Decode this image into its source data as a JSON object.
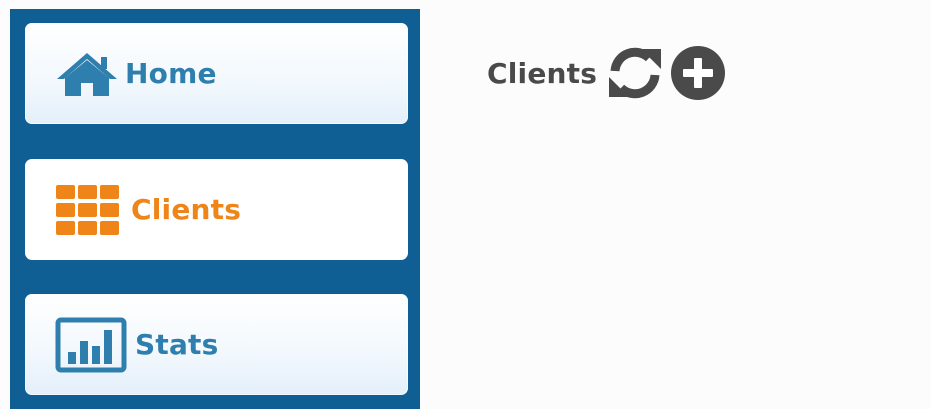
{
  "sidebar": {
    "items": [
      {
        "label": "Home",
        "icon": "home-icon",
        "color": "#2f7fae"
      },
      {
        "label": "Clients",
        "icon": "grid-icon",
        "color": "#ef8418",
        "active": true
      },
      {
        "label": "Stats",
        "icon": "bar-chart-icon",
        "color": "#2f7fae"
      }
    ],
    "background": "#0f5f95"
  },
  "main": {
    "title": "Clients",
    "actions": [
      {
        "icon": "refresh-icon"
      },
      {
        "icon": "add-circle-icon"
      }
    ]
  }
}
